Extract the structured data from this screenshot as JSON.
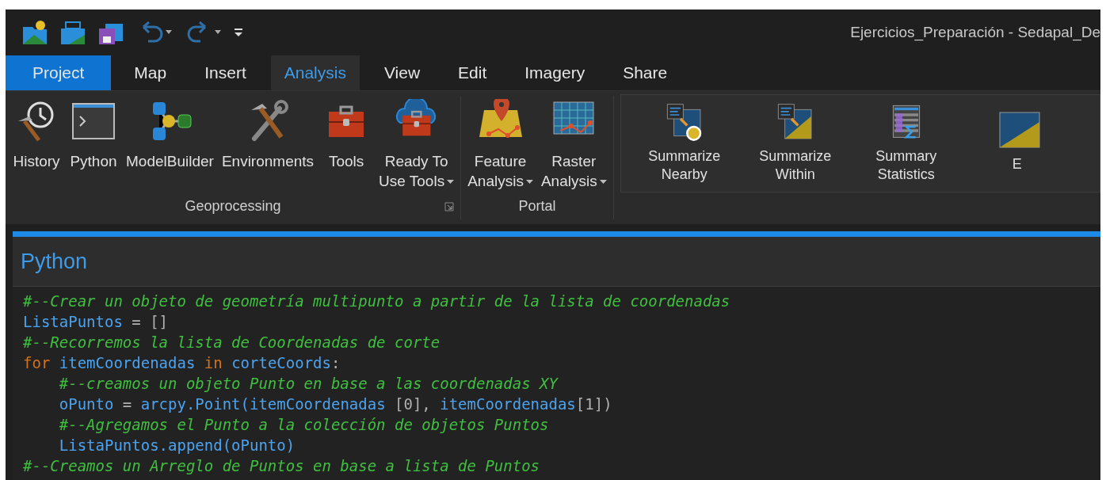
{
  "window": {
    "title": "Ejercicios_Preparación - Sedapal_De"
  },
  "tabs": [
    {
      "label": "Project",
      "kind": "backstage",
      "selected": false
    },
    {
      "label": "Map",
      "kind": "tab",
      "selected": false
    },
    {
      "label": "Insert",
      "kind": "tab",
      "selected": false
    },
    {
      "label": "Analysis",
      "kind": "tab",
      "selected": true
    },
    {
      "label": "View",
      "kind": "tab",
      "selected": false
    },
    {
      "label": "Edit",
      "kind": "tab",
      "selected": false
    },
    {
      "label": "Imagery",
      "kind": "tab",
      "selected": false
    },
    {
      "label": "Share",
      "kind": "tab",
      "selected": false
    }
  ],
  "ribbon": {
    "groups": [
      {
        "label": "Geoprocessing",
        "buttons": [
          {
            "lines": [
              "History"
            ],
            "dropdown": false
          },
          {
            "lines": [
              "Python"
            ],
            "dropdown": false
          },
          {
            "lines": [
              "ModelBuilder"
            ],
            "dropdown": false
          },
          {
            "lines": [
              "Environments"
            ],
            "dropdown": false
          },
          {
            "lines": [
              "Tools"
            ],
            "dropdown": false
          },
          {
            "lines": [
              "Ready To",
              "Use Tools"
            ],
            "dropdown": true
          }
        ]
      },
      {
        "label": "Portal",
        "buttons": [
          {
            "lines": [
              "Feature",
              "Analysis"
            ],
            "dropdown": true
          },
          {
            "lines": [
              "Raster",
              "Analysis"
            ],
            "dropdown": true
          }
        ]
      }
    ],
    "gallery": [
      {
        "lines": [
          "Summarize",
          "Nearby"
        ]
      },
      {
        "lines": [
          "Summarize",
          "Within"
        ]
      },
      {
        "lines": [
          "Summary",
          "Statistics"
        ]
      },
      {
        "lines": [
          "E"
        ]
      }
    ]
  },
  "python_pane": {
    "title": "Python",
    "code": [
      [
        {
          "kind": "comment",
          "text": "#--Crear un objeto de geometría multipunto a partir de la lista de coordenadas"
        }
      ],
      [
        {
          "kind": "name",
          "text": "ListaPuntos"
        },
        {
          "kind": "op",
          "text": " = []"
        }
      ],
      [
        {
          "kind": "comment",
          "text": "#--Recorremos la lista de Coordenadas de corte"
        }
      ],
      [
        {
          "kind": "keyword",
          "text": "for"
        },
        {
          "kind": "name",
          "text": " itemCoordenadas "
        },
        {
          "kind": "keyword",
          "text": "in"
        },
        {
          "kind": "name",
          "text": " corteCoords"
        },
        {
          "kind": "op",
          "text": ":"
        }
      ],
      [
        {
          "kind": "comment",
          "text": "    #--creamos un objeto Punto en base a las coordenadas XY"
        }
      ],
      [
        {
          "kind": "name",
          "text": "    oPunto"
        },
        {
          "kind": "op",
          "text": " = "
        },
        {
          "kind": "name",
          "text": "arcpy.Point(itemCoordenadas "
        },
        {
          "kind": "op",
          "text": "[0], "
        },
        {
          "kind": "name",
          "text": "itemCoordenadas"
        },
        {
          "kind": "op",
          "text": "[1])"
        }
      ],
      [
        {
          "kind": "comment",
          "text": "    #--Agregamos el Punto a la colección de objetos Puntos"
        }
      ],
      [
        {
          "kind": "name",
          "text": "    ListaPuntos.append(oPunto)"
        }
      ],
      [
        {
          "kind": "comment",
          "text": "#--Creamos un Arreglo de Puntos en base a lista de Puntos"
        }
      ]
    ]
  }
}
